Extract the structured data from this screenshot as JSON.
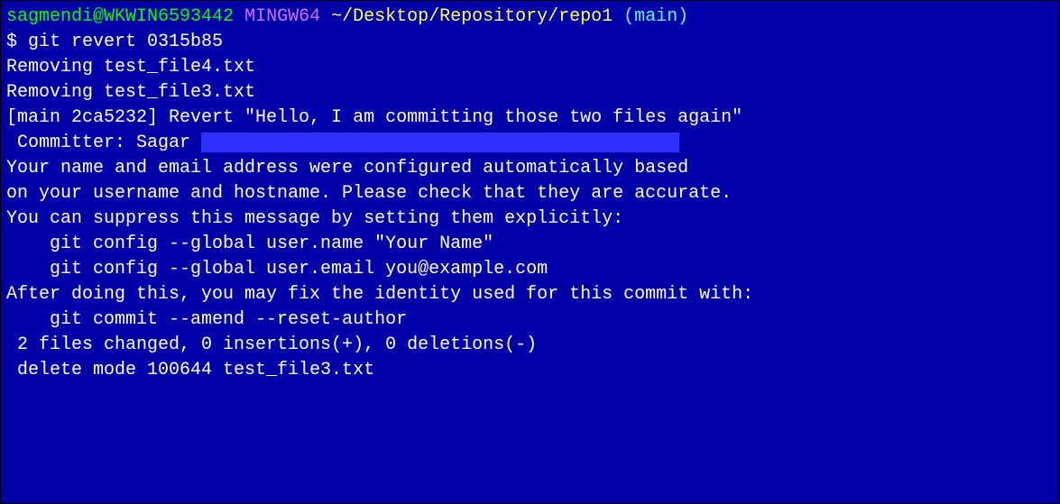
{
  "prompt": {
    "user": "sagmendi@WKWIN6593442",
    "mingw": "MINGW64",
    "path": "~/Desktop/Repository/repo1",
    "branch": "(main)"
  },
  "command": "$ git revert 0315b85",
  "output": {
    "l1": "Removing test_file4.txt",
    "l2": "Removing test_file3.txt",
    "l3": "[main 2ca5232] Revert \"Hello, I am committing those two files again\"",
    "l4_prefix": " Committer: Sagar ",
    "l5": "Your name and email address were configured automatically based",
    "l6": "on your username and hostname. Please check that they are accurate.",
    "l7": "You can suppress this message by setting them explicitly:",
    "l8": "",
    "l9": "    git config --global user.name \"Your Name\"",
    "l10": "    git config --global user.email you@example.com",
    "l11": "",
    "l12": "After doing this, you may fix the identity used for this commit with:",
    "l13": "",
    "l14": "    git commit --amend --reset-author",
    "l15": "",
    "l16": " 2 files changed, 0 insertions(+), 0 deletions(-)",
    "l17": " delete mode 100644 test_file3.txt"
  }
}
